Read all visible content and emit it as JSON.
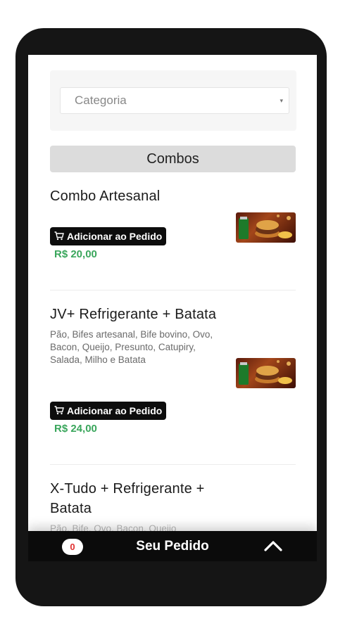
{
  "filter": {
    "category_placeholder": "Categoria",
    "caret": "▾"
  },
  "section": {
    "title": "Combos"
  },
  "products": [
    {
      "title": "Combo Artesanal",
      "description": "",
      "add_label": "Adicionar ao Pedido",
      "price": "R$ 20,00"
    },
    {
      "title": "JV+ Refrigerante + Batata",
      "description": "Pão, Bifes artesanal, Bife bovino, Ovo, Bacon, Queijo, Presunto, Catupiry, Salada, Milho e Batata",
      "add_label": "Adicionar ao Pedido",
      "price": "R$ 24,00"
    },
    {
      "title": "X-Tudo + Refrigerante + Batata",
      "description": "Pão, Bife, Ovo, Bacon, Queijo"
    }
  ],
  "order_bar": {
    "count": "0",
    "label": "Seu Pedido"
  },
  "colors": {
    "price": "#3aa65c",
    "badge_text": "#e03131",
    "button_bg": "#0d0d0d"
  },
  "icons": [
    "cart-icon",
    "chevron-up-icon",
    "caret-down-icon"
  ]
}
